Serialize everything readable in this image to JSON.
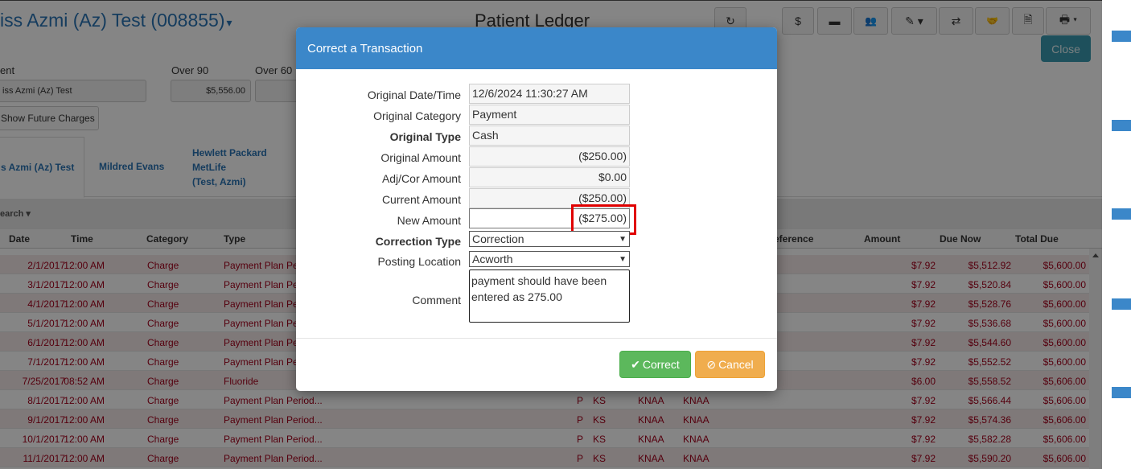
{
  "header": {
    "patient_name": "iss Azmi (Az) Test (008855)",
    "caret": "▾",
    "page_title": "Patient Ledger",
    "close_label": "Close",
    "toolbar": [
      "↻",
      "$",
      "▬",
      "👥",
      "✎ ▾",
      "⇄",
      "🤝",
      "🗎",
      "🖶 ▾"
    ]
  },
  "summary": {
    "patient_label": "ent",
    "patient_value": "iss Azmi (Az) Test",
    "over90_label": "Over 90",
    "over90_value": "$5,556.00",
    "over60_label": "Over 60",
    "future_charges_label": "Show Future Charges"
  },
  "tabs": [
    {
      "label": "s Azmi (Az) Test"
    },
    {
      "label": "Mildred Evans"
    },
    {
      "label": "Hewlett Packard\nMetLife\n(Test, Azmi)"
    }
  ],
  "search_label": "earch ▾",
  "columns": {
    "date": "Date",
    "time": "Time",
    "category": "Category",
    "type": "Type",
    "reference": "eference",
    "amount": "Amount",
    "due_now": "Due Now",
    "total_due": "Total Due"
  },
  "rows": [
    {
      "date": "2/1/2017",
      "time": "12:00 AM",
      "category": "Charge",
      "type": "Payment Plan Pe",
      "p": "",
      "prov": "",
      "a": "",
      "b": "",
      "amount": "$7.92",
      "due_now": "$5,512.92",
      "total_due": "$5,600.00"
    },
    {
      "date": "3/1/2017",
      "time": "12:00 AM",
      "category": "Charge",
      "type": "Payment Plan Pe",
      "p": "",
      "prov": "",
      "a": "",
      "b": "",
      "amount": "$7.92",
      "due_now": "$5,520.84",
      "total_due": "$5,600.00"
    },
    {
      "date": "4/1/2017",
      "time": "12:00 AM",
      "category": "Charge",
      "type": "Payment Plan Pe",
      "p": "",
      "prov": "",
      "a": "",
      "b": "",
      "amount": "$7.92",
      "due_now": "$5,528.76",
      "total_due": "$5,600.00"
    },
    {
      "date": "5/1/2017",
      "time": "12:00 AM",
      "category": "Charge",
      "type": "Payment Plan Pe",
      "p": "",
      "prov": "",
      "a": "",
      "b": "",
      "amount": "$7.92",
      "due_now": "$5,536.68",
      "total_due": "$5,600.00"
    },
    {
      "date": "6/1/2017",
      "time": "12:00 AM",
      "category": "Charge",
      "type": "Payment Plan Pe",
      "p": "",
      "prov": "",
      "a": "",
      "b": "",
      "amount": "$7.92",
      "due_now": "$5,544.60",
      "total_due": "$5,600.00"
    },
    {
      "date": "7/1/2017",
      "time": "12:00 AM",
      "category": "Charge",
      "type": "Payment Plan Pe",
      "p": "",
      "prov": "",
      "a": "",
      "b": "",
      "amount": "$7.92",
      "due_now": "$5,552.52",
      "total_due": "$5,600.00"
    },
    {
      "date": "7/25/2017",
      "time": "08:52 AM",
      "category": "Charge",
      "type": "Fluoride",
      "p": "",
      "prov": "",
      "a": "",
      "b": "",
      "amount": "$6.00",
      "due_now": "$5,558.52",
      "total_due": "$5,606.00"
    },
    {
      "date": "8/1/2017",
      "time": "12:00 AM",
      "category": "Charge",
      "type": "Payment Plan Period...",
      "p": "P",
      "prov": "KS",
      "a": "KNAA",
      "b": "KNAA",
      "amount": "$7.92",
      "due_now": "$5,566.44",
      "total_due": "$5,606.00"
    },
    {
      "date": "9/1/2017",
      "time": "12:00 AM",
      "category": "Charge",
      "type": "Payment Plan Period...",
      "p": "P",
      "prov": "KS",
      "a": "KNAA",
      "b": "KNAA",
      "amount": "$7.92",
      "due_now": "$5,574.36",
      "total_due": "$5,606.00"
    },
    {
      "date": "10/1/2017",
      "time": "12:00 AM",
      "category": "Charge",
      "type": "Payment Plan Period...",
      "p": "P",
      "prov": "KS",
      "a": "KNAA",
      "b": "KNAA",
      "amount": "$7.92",
      "due_now": "$5,582.28",
      "total_due": "$5,606.00"
    },
    {
      "date": "11/1/2017",
      "time": "12:00 AM",
      "category": "Charge",
      "type": "Payment Plan Period...",
      "p": "P",
      "prov": "KS",
      "a": "KNAA",
      "b": "KNAA",
      "amount": "$7.92",
      "due_now": "$5,590.20",
      "total_due": "$5,606.00"
    }
  ],
  "modal": {
    "title": "Correct a Transaction",
    "fields": {
      "original_datetime_label": "Original Date/Time",
      "original_datetime": "12/6/2024 11:30:27 AM",
      "original_category_label": "Original Category",
      "original_category": "Payment",
      "original_type_label": "Original Type",
      "original_type": "Cash",
      "original_amount_label": "Original Amount",
      "original_amount": "($250.00)",
      "adj_amount_label": "Adj/Cor Amount",
      "adj_amount": "$0.00",
      "current_amount_label": "Current Amount",
      "current_amount": "($250.00)",
      "new_amount_label": "New Amount",
      "new_amount": "($275.00)",
      "correction_type_label": "Correction Type",
      "correction_type": "Correction",
      "posting_location_label": "Posting Location",
      "posting_location": "Acworth",
      "comment_label": "Comment",
      "comment": "payment should have been entered as 275.00"
    },
    "correct_label": "Correct",
    "cancel_label": "Cancel",
    "highlight_color": "#e00000"
  },
  "colors": {
    "accent": "#3b87c9",
    "success": "#5cb85c",
    "warning": "#f0ad4e",
    "charge_text": "#a4001b"
  }
}
